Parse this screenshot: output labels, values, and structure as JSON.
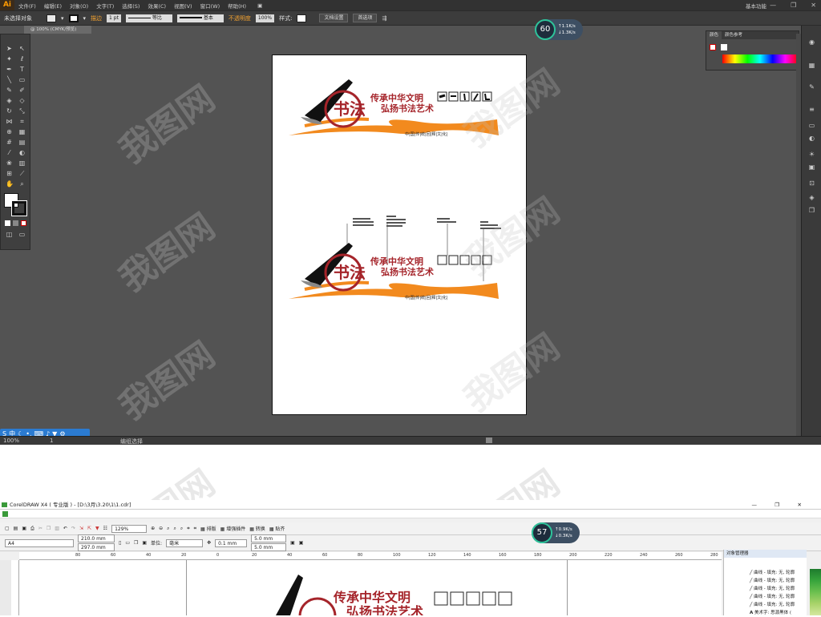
{
  "illustrator": {
    "logo": "Ai",
    "menus": [
      "文件(F)",
      "编辑(E)",
      "对象(O)",
      "文字(T)",
      "选择(S)",
      "效果(C)",
      "视图(V)",
      "窗口(W)",
      "帮助(H)"
    ],
    "workspace": "基本功能",
    "control_bar": {
      "selection": "未选择对象",
      "stroke_label": "描边",
      "stroke_value": "1 pt",
      "profile_label": "等比",
      "brush_label": "基本",
      "opacity_label": "不透明度",
      "opacity_value": "100%",
      "style_label": "样式:",
      "doc_setup": "文档设置",
      "prefs": "首选项"
    },
    "doc_tab": "@ 100% (CMYK/预览)",
    "color_panel": {
      "tab1": "颜色",
      "tab2": "颜色参考"
    },
    "status": {
      "zoom": "100%",
      "page": "1",
      "mode": "编组选择"
    },
    "ime": {
      "label": "中"
    },
    "gauge": {
      "percent": "60",
      "unit": "%",
      "up": "1.1",
      "down": "1.3",
      "rate_unit": "K/s"
    }
  },
  "artwork": {
    "title1": "传承中华文明",
    "title2": "弘扬书法艺术",
    "seal": "书法",
    "tagline": "中|国|传|统|回|释|文|化|"
  },
  "coreldraw": {
    "title": "CorelDRAW X4 ( 专业版 ) - [D:\\3月\\3.20\\1\\1.cdr]",
    "paper": "A4",
    "width": "210.0 mm",
    "height": "297.0 mm",
    "zoom": "129%",
    "units_label": "单位:",
    "units": "毫米",
    "nudge": "0.1 mm",
    "dup_x": "5.0 mm",
    "dup_y": "5.0 mm",
    "menu_typeset": "排版",
    "menu_plugins": "增强插件",
    "menu_convert": "转换",
    "menu_paste": "贴齐",
    "ruler_ticks": [
      "80",
      "60",
      "40",
      "20",
      "0",
      "20",
      "40",
      "60",
      "80",
      "100",
      "120",
      "140",
      "160",
      "180",
      "200",
      "220",
      "240",
      "260",
      "280"
    ],
    "obj_manager": {
      "title": "对象管理器",
      "items": [
        "曲线 - 填充: 无, 轮廓",
        "曲线 - 填充: 无, 轮廓",
        "曲线 - 填充: 无, 轮廓",
        "曲线 - 填充: 无, 轮廓",
        "曲线 - 填充: 无, 轮廓",
        "美术字: 思源黑体 ("
      ]
    },
    "gauge": {
      "percent": "57",
      "unit": "%",
      "up": "0.9",
      "down": "0.3",
      "rate_unit": "K/s"
    }
  },
  "colors": {
    "brand_red": "#a5242a",
    "orange": "#f28a1e",
    "ai_bg": "#535353"
  }
}
